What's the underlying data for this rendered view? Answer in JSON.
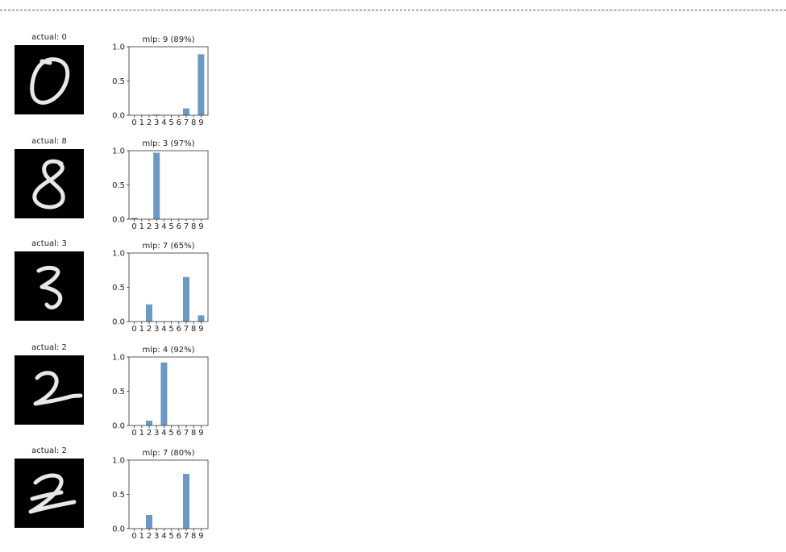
{
  "colors": {
    "bar": "#6b98c4",
    "axis": "#333333",
    "digit_bg": "#000000",
    "digit_stroke": "#e8e8e8"
  },
  "chart_data": [
    {
      "type": "bar",
      "image_title": "actual: 0",
      "title": "mlp: 9 (89%)",
      "categories": [
        "0",
        "1",
        "2",
        "3",
        "4",
        "5",
        "6",
        "7",
        "8",
        "9"
      ],
      "values": [
        0.0,
        0.0,
        0.0,
        0.01,
        0.0,
        0.0,
        0.0,
        0.1,
        0.0,
        0.89
      ],
      "ylim": [
        0,
        1
      ],
      "yticks": [
        "0.0",
        "0.5",
        "1.0"
      ],
      "digit_icon": "handwritten-0-icon"
    },
    {
      "type": "bar",
      "image_title": "actual: 8",
      "title": "mlp: 3 (97%)",
      "categories": [
        "0",
        "1",
        "2",
        "3",
        "4",
        "5",
        "6",
        "7",
        "8",
        "9"
      ],
      "values": [
        0.02,
        0.0,
        0.0,
        0.97,
        0.0,
        0.0,
        0.0,
        0.0,
        0.0,
        0.0
      ],
      "ylim": [
        0,
        1
      ],
      "yticks": [
        "0.0",
        "0.5",
        "1.0"
      ],
      "digit_icon": "handwritten-8-icon"
    },
    {
      "type": "bar",
      "image_title": "actual: 3",
      "title": "mlp: 7 (65%)",
      "categories": [
        "0",
        "1",
        "2",
        "3",
        "4",
        "5",
        "6",
        "7",
        "8",
        "9"
      ],
      "values": [
        0.0,
        0.0,
        0.25,
        0.0,
        0.0,
        0.0,
        0.0,
        0.65,
        0.0,
        0.09
      ],
      "ylim": [
        0,
        1
      ],
      "yticks": [
        "0.0",
        "0.5",
        "1.0"
      ],
      "digit_icon": "handwritten-3-icon"
    },
    {
      "type": "bar",
      "image_title": "actual: 2",
      "title": "mlp: 4 (92%)",
      "categories": [
        "0",
        "1",
        "2",
        "3",
        "4",
        "5",
        "6",
        "7",
        "8",
        "9"
      ],
      "values": [
        0.0,
        0.0,
        0.07,
        0.0,
        0.92,
        0.0,
        0.0,
        0.0,
        0.0,
        0.0
      ],
      "ylim": [
        0,
        1
      ],
      "yticks": [
        "0.0",
        "0.5",
        "1.0"
      ],
      "digit_icon": "handwritten-2-icon"
    },
    {
      "type": "bar",
      "image_title": "actual: 2",
      "title": "mlp: 7 (80%)",
      "categories": [
        "0",
        "1",
        "2",
        "3",
        "4",
        "5",
        "6",
        "7",
        "8",
        "9"
      ],
      "values": [
        0.0,
        0.0,
        0.2,
        0.0,
        0.0,
        0.0,
        0.0,
        0.8,
        0.0,
        0.0
      ],
      "ylim": [
        0,
        1
      ],
      "yticks": [
        "0.0",
        "0.5",
        "1.0"
      ],
      "digit_icon": "handwritten-2-slanted-icon"
    }
  ]
}
